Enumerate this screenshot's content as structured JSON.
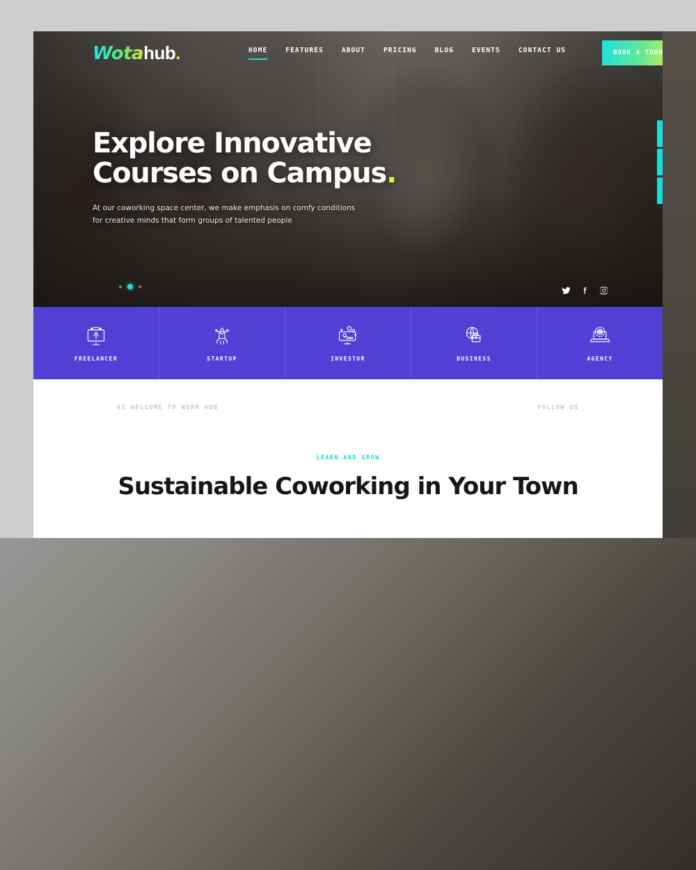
{
  "site": {
    "logo": {
      "part1": "Wota",
      "part2": "hub",
      "dot": "."
    }
  },
  "nav": {
    "items": [
      {
        "label": "HOME",
        "active": true
      },
      {
        "label": "FEATURES",
        "active": false
      },
      {
        "label": "ABOUT",
        "active": false
      },
      {
        "label": "PRICING",
        "active": false
      },
      {
        "label": "BLOG",
        "active": false
      },
      {
        "label": "EVENTS",
        "active": false
      },
      {
        "label": "CONTACT US",
        "active": false
      }
    ],
    "cta_label": "BOOK A TOUR"
  },
  "hero": {
    "title_line1": "Explore Innovative",
    "title_line2": "Courses on Campus",
    "title_dot": ".",
    "subtitle_line1": "At our coworking space center, we make emphasis on comfy conditions",
    "subtitle_line2": "for creative minds that form groups of talented people",
    "slider": {
      "total": 3,
      "active_index": 1
    },
    "social": [
      {
        "name": "twitter-icon"
      },
      {
        "name": "facebook-icon"
      },
      {
        "name": "instagram-icon"
      }
    ]
  },
  "side_rail": [
    {
      "name": "cart-icon"
    },
    {
      "name": "gallery-icon"
    },
    {
      "name": "window-icon"
    }
  ],
  "categories": [
    {
      "label": "FREELANCER",
      "icon": "monitor-rocket-icon"
    },
    {
      "label": "STARTUP",
      "icon": "rocket-icon"
    },
    {
      "label": "INVESTOR",
      "icon": "monitor-coins-icon"
    },
    {
      "label": "BUSINESS",
      "icon": "globe-briefcase-icon"
    },
    {
      "label": "AGENCY",
      "icon": "laptop-gear-icon"
    }
  ],
  "welcome": {
    "kicker": "01 WELCOME TO WORK HUB",
    "follow_label": "FOLLOW US",
    "eyebrow": "LEARN AND GROW",
    "heading": "Sustainable Coworking in Your Town"
  },
  "colors": {
    "accent_cyan": "#20dede",
    "accent_yellow": "#dcf23c",
    "category_purple": "#5240d6",
    "heading_dark": "#15161a",
    "muted_gray": "#c3c6cf",
    "page_backdrop": "#cdcdcd",
    "overlay_dark": "#413e39"
  }
}
